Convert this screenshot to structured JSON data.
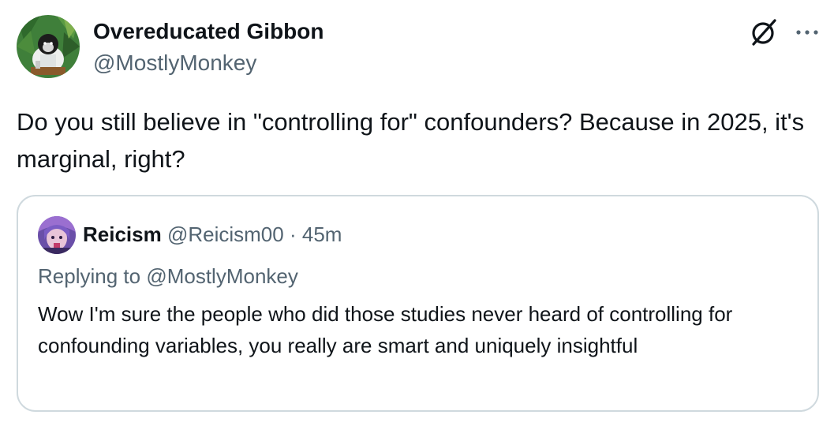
{
  "tweet": {
    "author": {
      "name": "Overeducated Gibbon",
      "handle": "@MostlyMonkey",
      "avatar_icon": "gibbon-avatar"
    },
    "actions": {
      "grok_icon": "grok-icon",
      "more_label": "···"
    },
    "text": "Do you still believe in \"controlling for\" confounders? Because in 2025, it's marginal, right?"
  },
  "quoted_tweet": {
    "author": {
      "name": "Reicism",
      "handle": "@Reicism00",
      "avatar_icon": "anime-avatar"
    },
    "separator": "·",
    "time": "45m",
    "replying_to_label": "Replying to",
    "replying_to_handle": "@MostlyMonkey",
    "text": "Wow I'm sure the people who did those studies never heard of controlling for confounding variables, you really are smart and uniquely insightful"
  },
  "colors": {
    "text_primary": "#0f1419",
    "text_secondary": "#536471",
    "border": "#cfd9de"
  }
}
